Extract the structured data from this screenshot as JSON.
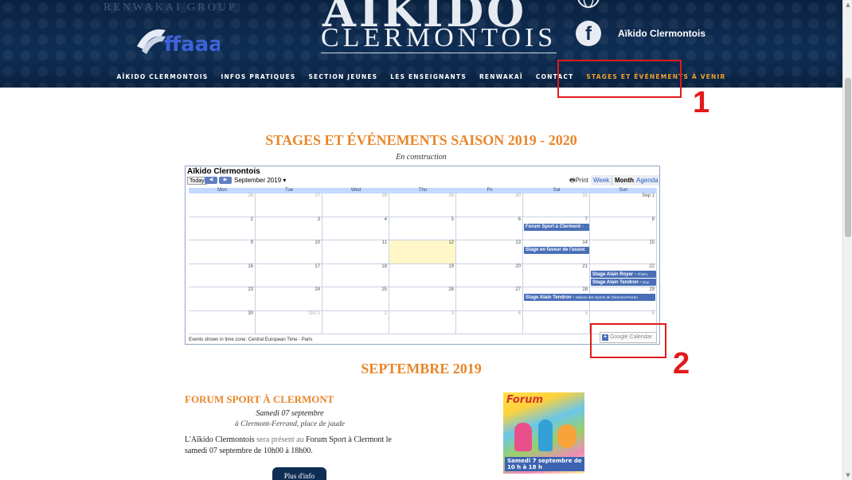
{
  "header": {
    "group_text": "RENWAKAI GROUP",
    "logo_top": "AIKIDO",
    "logo_bottom": "CLERMONTOIS",
    "federation_logo": "ffaaa",
    "facebook_label": "Aïkido Clermontois",
    "icons": [
      "globe-icon",
      "facebook-icon"
    ]
  },
  "nav": [
    "AÏKIDO CLERMONTOIS",
    "INFOS PRATIQUES",
    "SECTION JEUNES",
    "LES ENSEIGNANTS",
    "RENWAKAÏ",
    "CONTACT",
    "STAGES ET ÉVÉNEMENTS À VENIR"
  ],
  "nav_active_index": 6,
  "annotations": {
    "marker1": "1",
    "marker2": "2",
    "color": "#e21a1a"
  },
  "page": {
    "title": "STAGES ET ÉVÉNEMENTS SAISON 2019 - 2020",
    "subtitle": "En construction",
    "accent_color": "#e8862a"
  },
  "calendar": {
    "name": "Aïkido Clermontois",
    "today_label": "Today",
    "month_label": "September 2019",
    "print_label": "Print",
    "views": [
      "Week",
      "Month",
      "Agenda"
    ],
    "selected_view": "Month",
    "day_headers": [
      "Mon",
      "Tue",
      "Wed",
      "Thu",
      "Fri",
      "Sat",
      "Sun"
    ],
    "weeks": [
      [
        "26",
        "27",
        "28",
        "29",
        "30",
        "31",
        "Sep 1"
      ],
      [
        "2",
        "3",
        "4",
        "5",
        "6",
        "7",
        "8"
      ],
      [
        "9",
        "10",
        "11",
        "12",
        "13",
        "14",
        "15"
      ],
      [
        "16",
        "17",
        "18",
        "19",
        "20",
        "21",
        "22"
      ],
      [
        "23",
        "24",
        "25",
        "26",
        "27",
        "28",
        "29"
      ],
      [
        "30",
        "Oct 1",
        "2",
        "3",
        "4",
        "5",
        "6"
      ]
    ],
    "today_cell": "12",
    "events": [
      {
        "week": 1,
        "day": 5,
        "title": "Forum Sport à Clermont -"
      },
      {
        "week": 2,
        "day": 5,
        "title": "Stage en faveur de l'assoc"
      },
      {
        "week": 3,
        "day": 6,
        "title": "Stage Alain Royer - ",
        "extra": "Thiers,"
      },
      {
        "week": 3,
        "day": 6,
        "title": "Stage Alain Tendron - ",
        "extra": "Doy"
      },
      {
        "week": 4,
        "day": 5,
        "title": "Stage Alain Tendron - ",
        "extra": "Maison des Sports de Clermont-Ferran"
      }
    ],
    "timezone_text": "Events shown in time zone: Central European Time - Paris",
    "gcal_label": "Google Calendar",
    "event_color": "#4a6fb7"
  },
  "month_section": {
    "title": "SEPTEMBRE 2019",
    "event_title": "FORUM SPORT À CLERMONT",
    "date": "Samedi 07 septembre",
    "place": "à Clermont-Ferrand, place de jaude",
    "text_parts": [
      "L'",
      "Aïkido Clermontois",
      " sera présent au ",
      "Forum Sport à Clermont",
      " le samedi 07 septembre de 10h00 à 18h00."
    ],
    "button_label": "Plus d'info",
    "poster": {
      "title": "Forum",
      "caption": "Samedi 7 septembre de 10 h à 18 h"
    }
  },
  "scrollbar": {
    "up": "▲",
    "down": "▼"
  }
}
